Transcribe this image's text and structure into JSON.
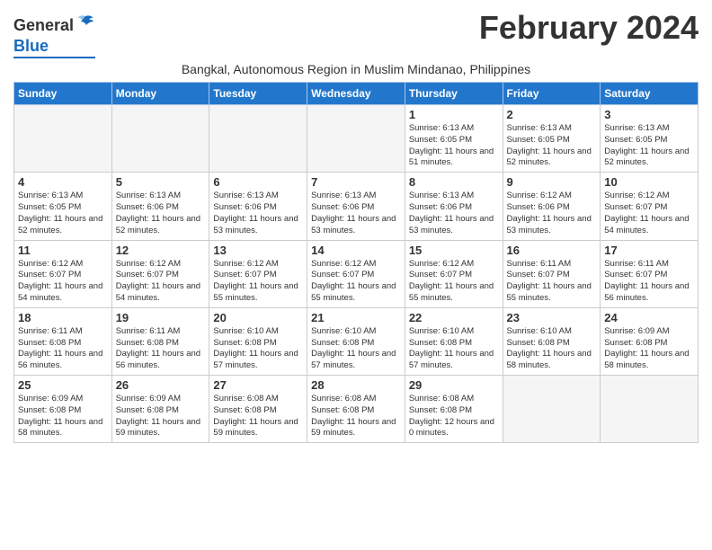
{
  "logo": {
    "general": "General",
    "blue": "Blue"
  },
  "title": "February 2024",
  "subtitle": "Bangkal, Autonomous Region in Muslim Mindanao, Philippines",
  "weekdays": [
    "Sunday",
    "Monday",
    "Tuesday",
    "Wednesday",
    "Thursday",
    "Friday",
    "Saturday"
  ],
  "weeks": [
    [
      {
        "day": "",
        "info": ""
      },
      {
        "day": "",
        "info": ""
      },
      {
        "day": "",
        "info": ""
      },
      {
        "day": "",
        "info": ""
      },
      {
        "day": "1",
        "info": "Sunrise: 6:13 AM\nSunset: 6:05 PM\nDaylight: 11 hours and 51 minutes."
      },
      {
        "day": "2",
        "info": "Sunrise: 6:13 AM\nSunset: 6:05 PM\nDaylight: 11 hours and 52 minutes."
      },
      {
        "day": "3",
        "info": "Sunrise: 6:13 AM\nSunset: 6:05 PM\nDaylight: 11 hours and 52 minutes."
      }
    ],
    [
      {
        "day": "4",
        "info": "Sunrise: 6:13 AM\nSunset: 6:05 PM\nDaylight: 11 hours and 52 minutes."
      },
      {
        "day": "5",
        "info": "Sunrise: 6:13 AM\nSunset: 6:06 PM\nDaylight: 11 hours and 52 minutes."
      },
      {
        "day": "6",
        "info": "Sunrise: 6:13 AM\nSunset: 6:06 PM\nDaylight: 11 hours and 53 minutes."
      },
      {
        "day": "7",
        "info": "Sunrise: 6:13 AM\nSunset: 6:06 PM\nDaylight: 11 hours and 53 minutes."
      },
      {
        "day": "8",
        "info": "Sunrise: 6:13 AM\nSunset: 6:06 PM\nDaylight: 11 hours and 53 minutes."
      },
      {
        "day": "9",
        "info": "Sunrise: 6:12 AM\nSunset: 6:06 PM\nDaylight: 11 hours and 53 minutes."
      },
      {
        "day": "10",
        "info": "Sunrise: 6:12 AM\nSunset: 6:07 PM\nDaylight: 11 hours and 54 minutes."
      }
    ],
    [
      {
        "day": "11",
        "info": "Sunrise: 6:12 AM\nSunset: 6:07 PM\nDaylight: 11 hours and 54 minutes."
      },
      {
        "day": "12",
        "info": "Sunrise: 6:12 AM\nSunset: 6:07 PM\nDaylight: 11 hours and 54 minutes."
      },
      {
        "day": "13",
        "info": "Sunrise: 6:12 AM\nSunset: 6:07 PM\nDaylight: 11 hours and 55 minutes."
      },
      {
        "day": "14",
        "info": "Sunrise: 6:12 AM\nSunset: 6:07 PM\nDaylight: 11 hours and 55 minutes."
      },
      {
        "day": "15",
        "info": "Sunrise: 6:12 AM\nSunset: 6:07 PM\nDaylight: 11 hours and 55 minutes."
      },
      {
        "day": "16",
        "info": "Sunrise: 6:11 AM\nSunset: 6:07 PM\nDaylight: 11 hours and 55 minutes."
      },
      {
        "day": "17",
        "info": "Sunrise: 6:11 AM\nSunset: 6:07 PM\nDaylight: 11 hours and 56 minutes."
      }
    ],
    [
      {
        "day": "18",
        "info": "Sunrise: 6:11 AM\nSunset: 6:08 PM\nDaylight: 11 hours and 56 minutes."
      },
      {
        "day": "19",
        "info": "Sunrise: 6:11 AM\nSunset: 6:08 PM\nDaylight: 11 hours and 56 minutes."
      },
      {
        "day": "20",
        "info": "Sunrise: 6:10 AM\nSunset: 6:08 PM\nDaylight: 11 hours and 57 minutes."
      },
      {
        "day": "21",
        "info": "Sunrise: 6:10 AM\nSunset: 6:08 PM\nDaylight: 11 hours and 57 minutes."
      },
      {
        "day": "22",
        "info": "Sunrise: 6:10 AM\nSunset: 6:08 PM\nDaylight: 11 hours and 57 minutes."
      },
      {
        "day": "23",
        "info": "Sunrise: 6:10 AM\nSunset: 6:08 PM\nDaylight: 11 hours and 58 minutes."
      },
      {
        "day": "24",
        "info": "Sunrise: 6:09 AM\nSunset: 6:08 PM\nDaylight: 11 hours and 58 minutes."
      }
    ],
    [
      {
        "day": "25",
        "info": "Sunrise: 6:09 AM\nSunset: 6:08 PM\nDaylight: 11 hours and 58 minutes."
      },
      {
        "day": "26",
        "info": "Sunrise: 6:09 AM\nSunset: 6:08 PM\nDaylight: 11 hours and 59 minutes."
      },
      {
        "day": "27",
        "info": "Sunrise: 6:08 AM\nSunset: 6:08 PM\nDaylight: 11 hours and 59 minutes."
      },
      {
        "day": "28",
        "info": "Sunrise: 6:08 AM\nSunset: 6:08 PM\nDaylight: 11 hours and 59 minutes."
      },
      {
        "day": "29",
        "info": "Sunrise: 6:08 AM\nSunset: 6:08 PM\nDaylight: 12 hours and 0 minutes."
      },
      {
        "day": "",
        "info": ""
      },
      {
        "day": "",
        "info": ""
      }
    ]
  ]
}
